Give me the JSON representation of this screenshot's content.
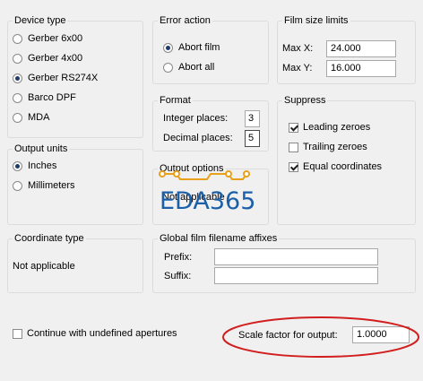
{
  "device_type": {
    "title": "Device type",
    "options": [
      "Gerber 6x00",
      "Gerber 4x00",
      "Gerber RS274X",
      "Barco DPF",
      "MDA"
    ],
    "selected": "Gerber RS274X"
  },
  "error_action": {
    "title": "Error action",
    "options": [
      "Abort film",
      "Abort all"
    ],
    "selected": "Abort film"
  },
  "film_size": {
    "title": "Film size limits",
    "max_x_label": "Max X:",
    "max_x": "24.000",
    "max_y_label": "Max Y:",
    "max_y": "16.000"
  },
  "format": {
    "title": "Format",
    "integer_label": "Integer places:",
    "integer_value": "3",
    "decimal_label": "Decimal places:",
    "decimal_value": "5"
  },
  "suppress": {
    "title": "Suppress",
    "options": [
      {
        "label": "Leading zeroes",
        "checked": true
      },
      {
        "label": "Trailing zeroes",
        "checked": false
      },
      {
        "label": "Equal coordinates",
        "checked": true
      }
    ]
  },
  "output_units": {
    "title": "Output units",
    "options": [
      "Inches",
      "Millimeters"
    ],
    "selected": "Inches"
  },
  "output_options": {
    "title": "Output options",
    "value": "Not applicable"
  },
  "watermark": {
    "text": "EDA365",
    "color": "#1a5fa8",
    "trace_color": "#e8a11a"
  },
  "coordinate_type": {
    "title": "Coordinate type",
    "value": "Not applicable"
  },
  "affixes": {
    "title": "Global film filename affixes",
    "prefix_label": "Prefix:",
    "prefix_value": "",
    "suffix_label": "Suffix:",
    "suffix_value": ""
  },
  "continue_undefined": {
    "label": "Continue with undefined apertures",
    "checked": false
  },
  "scale": {
    "label": "Scale factor for output:",
    "value": "1.0000"
  },
  "highlight_color": "#d21e1e"
}
